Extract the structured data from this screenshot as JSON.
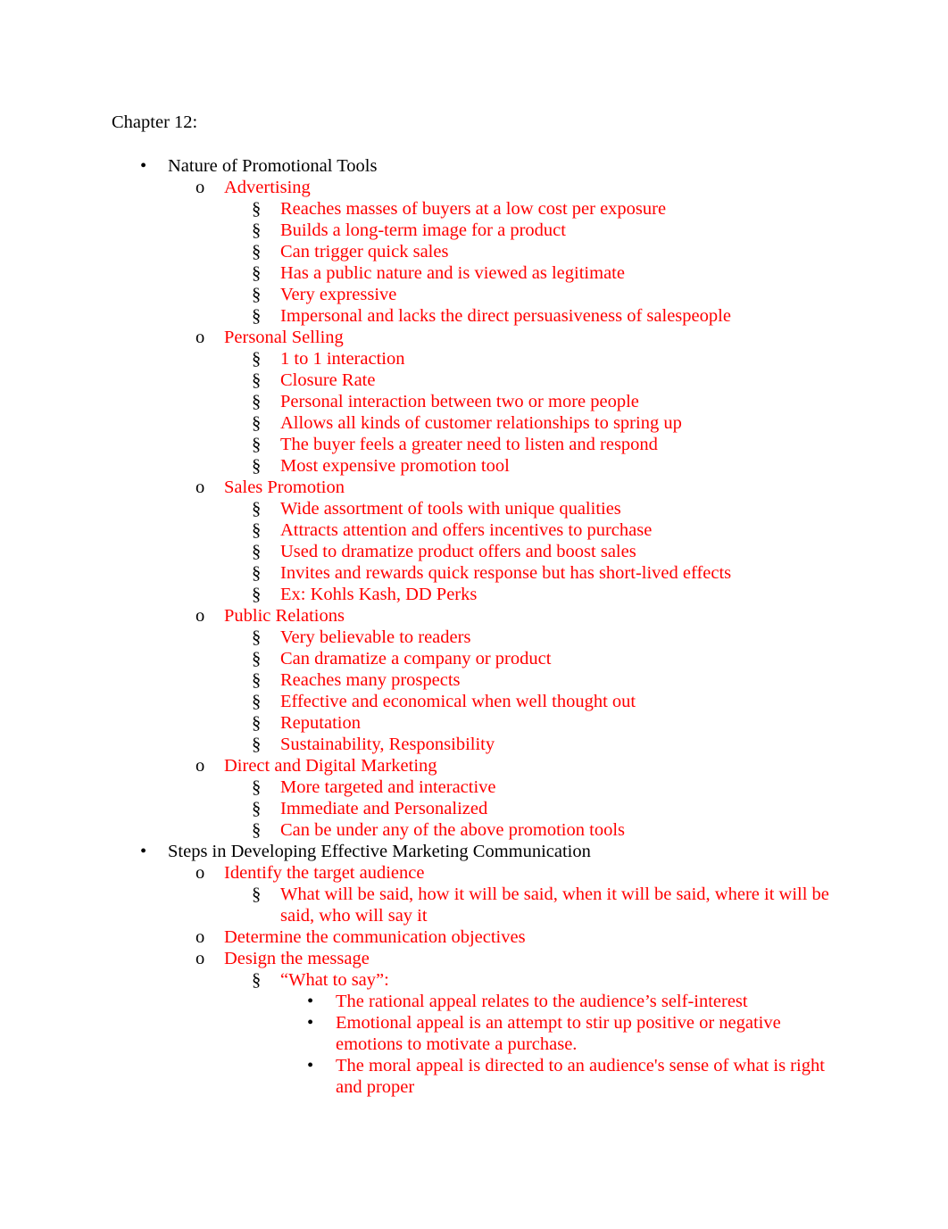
{
  "document": {
    "title": "Chapter 12:",
    "text_color": "#000000",
    "accent_color": "#ff0000",
    "markers": {
      "level1": "•",
      "level2": "o",
      "level3": "§",
      "level4": "•"
    },
    "sections": [
      {
        "heading": "Nature of Promotional Tools",
        "topics": [
          {
            "label": "Advertising",
            "points": [
              "Reaches masses of buyers at a low cost per exposure",
              "Builds a long-term image for a product",
              "Can trigger quick sales",
              "Has a public nature and is viewed as legitimate",
              "Very expressive",
              "Impersonal and lacks the direct persuasiveness of salespeople"
            ]
          },
          {
            "label": "Personal Selling",
            "points": [
              "1 to 1 interaction",
              "Closure Rate",
              "Personal interaction between two or more people",
              "Allows all kinds of customer relationships to spring up",
              "The buyer feels a greater need to listen and respond",
              "Most expensive promotion tool"
            ]
          },
          {
            "label": "Sales Promotion",
            "points": [
              "Wide assortment of tools with unique qualities",
              "Attracts attention and offers incentives to purchase",
              "Used to dramatize product offers and boost sales",
              "Invites and rewards quick response but has short-lived effects",
              "Ex: Kohls Kash, DD Perks"
            ]
          },
          {
            "label": "Public Relations",
            "points": [
              "Very believable to readers",
              "Can dramatize a company or product",
              "Reaches many prospects",
              "Effective and economical when well thought out",
              "Reputation",
              "Sustainability, Responsibility"
            ]
          },
          {
            "label": "Direct and Digital Marketing",
            "points": [
              "More targeted and interactive",
              "Immediate and Personalized",
              "Can be under any of the above promotion tools"
            ]
          }
        ]
      },
      {
        "heading": "Steps in Developing Effective Marketing Communication",
        "topics": [
          {
            "label": "Identify the target audience",
            "points": [
              "What will be said, how it will be said, when it will be said, where it will be said, who will say it"
            ]
          },
          {
            "label": "Determine the communication objectives",
            "points": []
          },
          {
            "label": "Design the message",
            "points": [
              "“What to say”:"
            ],
            "subpoints": [
              "The rational appeal relates to the audience’s self-interest",
              "Emotional appeal is an attempt to stir up positive or negative emotions to motivate a purchase.",
              "The moral appeal is directed to an audience's sense of what is right and proper"
            ]
          }
        ]
      }
    ]
  }
}
